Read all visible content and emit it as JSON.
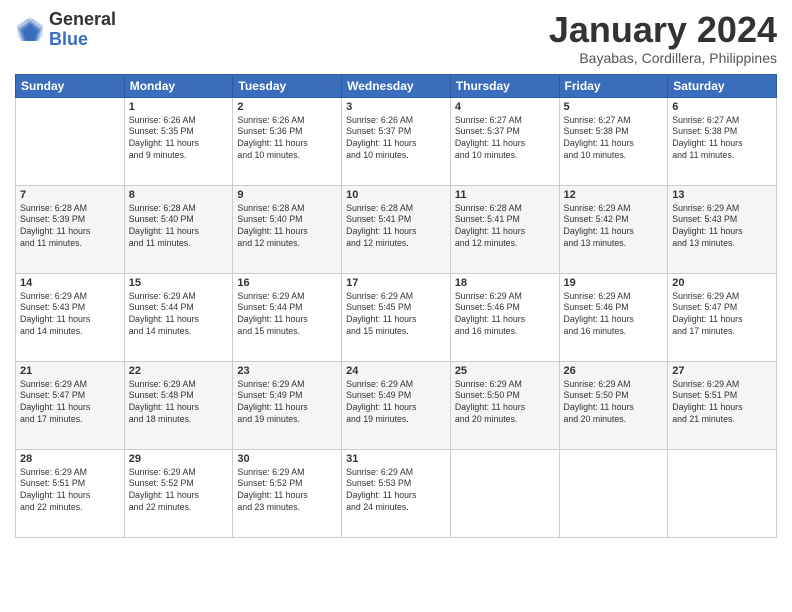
{
  "logo": {
    "general": "General",
    "blue": "Blue"
  },
  "header": {
    "month": "January 2024",
    "location": "Bayabas, Cordillera, Philippines"
  },
  "days_of_week": [
    "Sunday",
    "Monday",
    "Tuesday",
    "Wednesday",
    "Thursday",
    "Friday",
    "Saturday"
  ],
  "weeks": [
    [
      {
        "day": "",
        "sunrise": "",
        "sunset": "",
        "daylight": ""
      },
      {
        "day": "1",
        "sunrise": "Sunrise: 6:26 AM",
        "sunset": "Sunset: 5:35 PM",
        "daylight": "Daylight: 11 hours and 9 minutes."
      },
      {
        "day": "2",
        "sunrise": "Sunrise: 6:26 AM",
        "sunset": "Sunset: 5:36 PM",
        "daylight": "Daylight: 11 hours and 10 minutes."
      },
      {
        "day": "3",
        "sunrise": "Sunrise: 6:26 AM",
        "sunset": "Sunset: 5:37 PM",
        "daylight": "Daylight: 11 hours and 10 minutes."
      },
      {
        "day": "4",
        "sunrise": "Sunrise: 6:27 AM",
        "sunset": "Sunset: 5:37 PM",
        "daylight": "Daylight: 11 hours and 10 minutes."
      },
      {
        "day": "5",
        "sunrise": "Sunrise: 6:27 AM",
        "sunset": "Sunset: 5:38 PM",
        "daylight": "Daylight: 11 hours and 10 minutes."
      },
      {
        "day": "6",
        "sunrise": "Sunrise: 6:27 AM",
        "sunset": "Sunset: 5:38 PM",
        "daylight": "Daylight: 11 hours and 11 minutes."
      }
    ],
    [
      {
        "day": "7",
        "sunrise": "Sunrise: 6:28 AM",
        "sunset": "Sunset: 5:39 PM",
        "daylight": "Daylight: 11 hours and 11 minutes."
      },
      {
        "day": "8",
        "sunrise": "Sunrise: 6:28 AM",
        "sunset": "Sunset: 5:40 PM",
        "daylight": "Daylight: 11 hours and 11 minutes."
      },
      {
        "day": "9",
        "sunrise": "Sunrise: 6:28 AM",
        "sunset": "Sunset: 5:40 PM",
        "daylight": "Daylight: 11 hours and 12 minutes."
      },
      {
        "day": "10",
        "sunrise": "Sunrise: 6:28 AM",
        "sunset": "Sunset: 5:41 PM",
        "daylight": "Daylight: 11 hours and 12 minutes."
      },
      {
        "day": "11",
        "sunrise": "Sunrise: 6:28 AM",
        "sunset": "Sunset: 5:41 PM",
        "daylight": "Daylight: 11 hours and 12 minutes."
      },
      {
        "day": "12",
        "sunrise": "Sunrise: 6:29 AM",
        "sunset": "Sunset: 5:42 PM",
        "daylight": "Daylight: 11 hours and 13 minutes."
      },
      {
        "day": "13",
        "sunrise": "Sunrise: 6:29 AM",
        "sunset": "Sunset: 5:43 PM",
        "daylight": "Daylight: 11 hours and 13 minutes."
      }
    ],
    [
      {
        "day": "14",
        "sunrise": "Sunrise: 6:29 AM",
        "sunset": "Sunset: 5:43 PM",
        "daylight": "Daylight: 11 hours and 14 minutes."
      },
      {
        "day": "15",
        "sunrise": "Sunrise: 6:29 AM",
        "sunset": "Sunset: 5:44 PM",
        "daylight": "Daylight: 11 hours and 14 minutes."
      },
      {
        "day": "16",
        "sunrise": "Sunrise: 6:29 AM",
        "sunset": "Sunset: 5:44 PM",
        "daylight": "Daylight: 11 hours and 15 minutes."
      },
      {
        "day": "17",
        "sunrise": "Sunrise: 6:29 AM",
        "sunset": "Sunset: 5:45 PM",
        "daylight": "Daylight: 11 hours and 15 minutes."
      },
      {
        "day": "18",
        "sunrise": "Sunrise: 6:29 AM",
        "sunset": "Sunset: 5:46 PM",
        "daylight": "Daylight: 11 hours and 16 minutes."
      },
      {
        "day": "19",
        "sunrise": "Sunrise: 6:29 AM",
        "sunset": "Sunset: 5:46 PM",
        "daylight": "Daylight: 11 hours and 16 minutes."
      },
      {
        "day": "20",
        "sunrise": "Sunrise: 6:29 AM",
        "sunset": "Sunset: 5:47 PM",
        "daylight": "Daylight: 11 hours and 17 minutes."
      }
    ],
    [
      {
        "day": "21",
        "sunrise": "Sunrise: 6:29 AM",
        "sunset": "Sunset: 5:47 PM",
        "daylight": "Daylight: 11 hours and 17 minutes."
      },
      {
        "day": "22",
        "sunrise": "Sunrise: 6:29 AM",
        "sunset": "Sunset: 5:48 PM",
        "daylight": "Daylight: 11 hours and 18 minutes."
      },
      {
        "day": "23",
        "sunrise": "Sunrise: 6:29 AM",
        "sunset": "Sunset: 5:49 PM",
        "daylight": "Daylight: 11 hours and 19 minutes."
      },
      {
        "day": "24",
        "sunrise": "Sunrise: 6:29 AM",
        "sunset": "Sunset: 5:49 PM",
        "daylight": "Daylight: 11 hours and 19 minutes."
      },
      {
        "day": "25",
        "sunrise": "Sunrise: 6:29 AM",
        "sunset": "Sunset: 5:50 PM",
        "daylight": "Daylight: 11 hours and 20 minutes."
      },
      {
        "day": "26",
        "sunrise": "Sunrise: 6:29 AM",
        "sunset": "Sunset: 5:50 PM",
        "daylight": "Daylight: 11 hours and 20 minutes."
      },
      {
        "day": "27",
        "sunrise": "Sunrise: 6:29 AM",
        "sunset": "Sunset: 5:51 PM",
        "daylight": "Daylight: 11 hours and 21 minutes."
      }
    ],
    [
      {
        "day": "28",
        "sunrise": "Sunrise: 6:29 AM",
        "sunset": "Sunset: 5:51 PM",
        "daylight": "Daylight: 11 hours and 22 minutes."
      },
      {
        "day": "29",
        "sunrise": "Sunrise: 6:29 AM",
        "sunset": "Sunset: 5:52 PM",
        "daylight": "Daylight: 11 hours and 22 minutes."
      },
      {
        "day": "30",
        "sunrise": "Sunrise: 6:29 AM",
        "sunset": "Sunset: 5:52 PM",
        "daylight": "Daylight: 11 hours and 23 minutes."
      },
      {
        "day": "31",
        "sunrise": "Sunrise: 6:29 AM",
        "sunset": "Sunset: 5:53 PM",
        "daylight": "Daylight: 11 hours and 24 minutes."
      },
      {
        "day": "",
        "sunrise": "",
        "sunset": "",
        "daylight": ""
      },
      {
        "day": "",
        "sunrise": "",
        "sunset": "",
        "daylight": ""
      },
      {
        "day": "",
        "sunrise": "",
        "sunset": "",
        "daylight": ""
      }
    ]
  ]
}
